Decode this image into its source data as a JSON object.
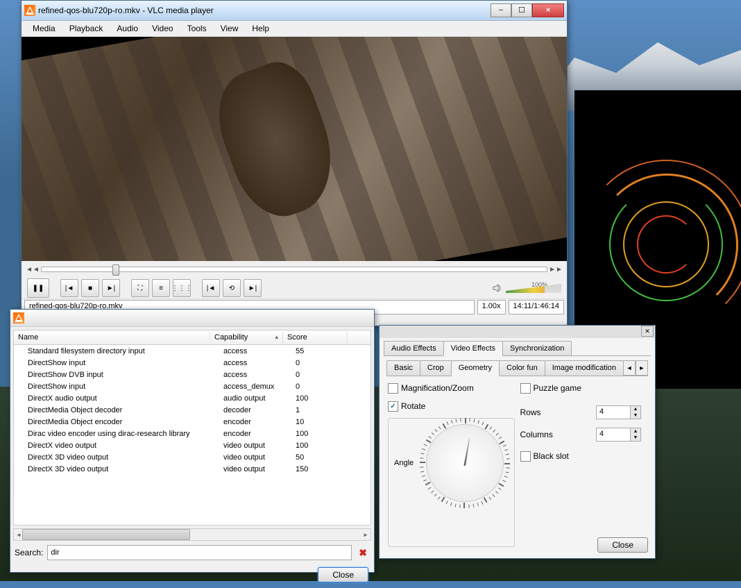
{
  "vlc": {
    "title": "refined-qos-blu720p-ro.mkv - VLC media player",
    "menu": [
      "Media",
      "Playback",
      "Audio",
      "Video",
      "Tools",
      "View",
      "Help"
    ],
    "volume_label": "100%",
    "status_file": "refined-qos-blu720p-ro.mkv",
    "speed": "1.00x",
    "time": "14:11/1:46:14"
  },
  "modules": {
    "headers": [
      "Name",
      "Capability",
      "Score"
    ],
    "rows": [
      {
        "name": "Standard filesystem directory input",
        "cap": "access",
        "score": "55"
      },
      {
        "name": "DirectShow input",
        "cap": "access",
        "score": "0"
      },
      {
        "name": "DirectShow DVB input",
        "cap": "access",
        "score": "0"
      },
      {
        "name": "DirectShow input",
        "cap": "access_demux",
        "score": "0"
      },
      {
        "name": "DirectX audio output",
        "cap": "audio output",
        "score": "100"
      },
      {
        "name": "DirectMedia Object decoder",
        "cap": "decoder",
        "score": "1"
      },
      {
        "name": "DirectMedia Object encoder",
        "cap": "encoder",
        "score": "10"
      },
      {
        "name": "Dirac video encoder using dirac-research library",
        "cap": "encoder",
        "score": "100"
      },
      {
        "name": "DirectX video output",
        "cap": "video output",
        "score": "100"
      },
      {
        "name": "DirectX 3D video output",
        "cap": "video output",
        "score": "50"
      },
      {
        "name": "DirectX 3D video output",
        "cap": "video output",
        "score": "150"
      }
    ],
    "search_label": "Search:",
    "search_value": "dir",
    "close": "Close"
  },
  "effects": {
    "main_tabs": [
      "Audio Effects",
      "Video Effects",
      "Synchronization"
    ],
    "sub_tabs": [
      "Basic",
      "Crop",
      "Geometry",
      "Color fun",
      "Image modification"
    ],
    "magnification": "Magnification/Zoom",
    "rotate": "Rotate",
    "angle": "Angle",
    "puzzle": "Puzzle game",
    "rows_label": "Rows",
    "rows_value": "4",
    "cols_label": "Columns",
    "cols_value": "4",
    "black_slot": "Black slot",
    "close": "Close"
  }
}
